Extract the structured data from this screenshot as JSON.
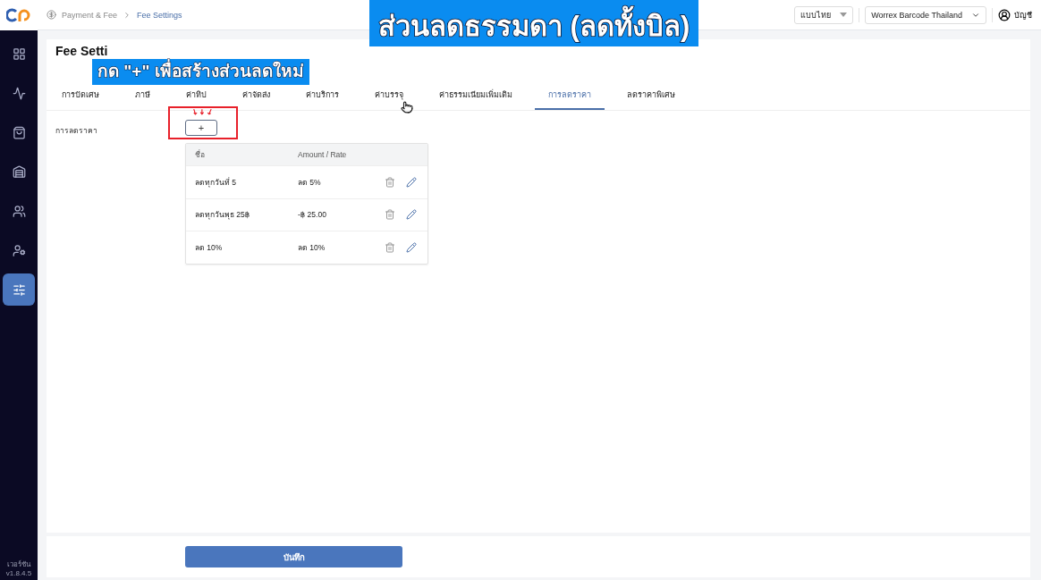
{
  "header": {
    "breadcrumb": [
      "Payment & Fee",
      "Fee Settings"
    ],
    "language": "แบบไทย",
    "store": "Worrex Barcode Thailand",
    "account": "บัญชี"
  },
  "sidebar": {
    "items": [
      {
        "kind": "grid",
        "selected": false
      },
      {
        "kind": "pulse",
        "selected": false
      },
      {
        "kind": "bag",
        "selected": false
      },
      {
        "kind": "store",
        "selected": false
      },
      {
        "kind": "users",
        "selected": false
      },
      {
        "kind": "user",
        "selected": false
      },
      {
        "kind": "sliders",
        "selected": true
      }
    ],
    "version_label": "เวอร์ชัน",
    "version": "v1.8.4.5"
  },
  "page": {
    "title": "Fee Setti",
    "tabs": [
      {
        "label": "การปัดเศษ",
        "selected": false
      },
      {
        "label": "ภาษี",
        "selected": false
      },
      {
        "label": "ค่าทิป",
        "selected": false
      },
      {
        "label": "ค่าจัดส่ง",
        "selected": false
      },
      {
        "label": "ค่าบริการ",
        "selected": false
      },
      {
        "label": "ค่าบรรจุ",
        "selected": false
      },
      {
        "label": "ค่าธรรมเนียมเพิ่มเติม",
        "selected": false
      },
      {
        "label": "การลดราคา",
        "selected": true
      },
      {
        "label": "ลดราคาพิเศษ",
        "selected": false
      }
    ],
    "section_label": "การลดราคา",
    "add_button": "+",
    "table": {
      "columns": [
        "ชื่อ",
        "Amount / Rate"
      ],
      "rows": [
        {
          "name": "ลดทุกวันที่ 5",
          "amount": "ลด 5%"
        },
        {
          "name": "ลดทุกวันพุธ 25฿",
          "amount": "-฿ 25.00"
        },
        {
          "name": "ลด 10%",
          "amount": "ลด 10%"
        }
      ]
    },
    "save_button": "บันทึก"
  },
  "captions": [
    {
      "text": "ส่วนลดธรรมดา (ลดทั้งบิล)"
    },
    {
      "text": "กด \"+\" เพื่อสร้างส่วนลดใหม่"
    }
  ]
}
